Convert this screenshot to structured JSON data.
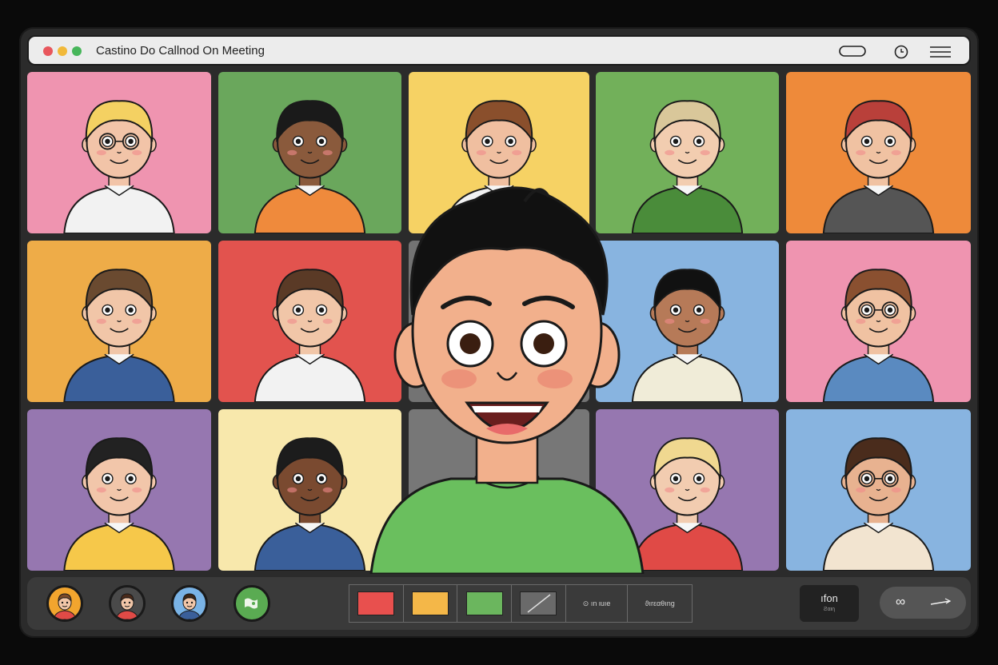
{
  "window": {
    "title": "Castino Do Callnod On Meeting"
  },
  "colors": {
    "dot_red": "#e8565c",
    "dot_yellow": "#f1b93a",
    "dot_green": "#47b65a",
    "background": "#0a0a0a",
    "control_bar": "#3a3a3a"
  },
  "participants": [
    {
      "name": "participant-1",
      "bg": "#ef94b0",
      "skin": "#f2c4a8",
      "hair": "#f4d162",
      "shirt": "#f2f2f2",
      "glasses": true
    },
    {
      "name": "participant-2",
      "bg": "#6aa75c",
      "skin": "#8a5a3c",
      "hair": "#1a1a1a",
      "shirt": "#ef8a3c",
      "glasses": false
    },
    {
      "name": "participant-3",
      "bg": "#f6d264",
      "skin": "#f0bfa0",
      "hair": "#8a4f2c",
      "shirt": "#f2f2f2",
      "glasses": false
    },
    {
      "name": "participant-4",
      "bg": "#72b05a",
      "skin": "#f2cdb0",
      "hair": "#d9c79a",
      "shirt": "#4a8c3a",
      "glasses": false
    },
    {
      "name": "participant-5",
      "bg": "#ee8a3a",
      "skin": "#f0c2a2",
      "hair": "#b9403a",
      "shirt": "#555555",
      "glasses": false
    },
    {
      "name": "participant-6",
      "bg": "#eeac48",
      "skin": "#f1c6a8",
      "hair": "#6a4a30",
      "shirt": "#3a5f9a",
      "glasses": false
    },
    {
      "name": "participant-7",
      "bg": "#e2534e",
      "skin": "#f1c6a8",
      "hair": "#5a3a26",
      "shirt": "#f2f2f2",
      "glasses": false
    },
    {
      "name": "participant-8",
      "bg": "#88b4e0",
      "skin": "#b67a58",
      "hair": "#111111",
      "shirt": "#f0ecd8",
      "glasses": false
    },
    {
      "name": "participant-9",
      "bg": "#ef94b0",
      "skin": "#f0c2a2",
      "hair": "#8a5030",
      "shirt": "#5a8ac0",
      "glasses": true
    },
    {
      "name": "participant-10",
      "bg": "#9677b0",
      "skin": "#f2c6aa",
      "hair": "#222222",
      "shirt": "#f6c84a",
      "glasses": false
    },
    {
      "name": "participant-11",
      "bg": "#f8e8ac",
      "skin": "#7a4a30",
      "hair": "#1c1c1c",
      "shirt": "#3a5f9a",
      "glasses": false
    },
    {
      "name": "participant-12",
      "bg": "#9677b0",
      "skin": "#f2ccb0",
      "hair": "#f0d890",
      "shirt": "#e04a46",
      "glasses": false
    },
    {
      "name": "participant-13",
      "bg": "#88b4e0",
      "skin": "#e8b290",
      "hair": "#4a2c1c",
      "shirt": "#f2e4d0",
      "glasses": true
    }
  ],
  "spotlight": {
    "skin": "#f2b08c",
    "hair": "#111111",
    "shirt": "#6abf5e",
    "behind_tile_colors": [
      "#737373",
      "#777777",
      "#808080"
    ]
  },
  "controls": {
    "avatars": [
      {
        "bg": "#f2a52e",
        "skin": "#f1c6a8",
        "hair": "#7a4a2a",
        "shirt": "#e04a46"
      },
      {
        "bg": "#4a4a4a",
        "skin": "#f1c6a8",
        "hair": "#4a2a1a",
        "shirt": "#e04a46"
      },
      {
        "bg": "#79b3e6",
        "skin": "#f1c6a8",
        "hair": "#3a2618",
        "shirt": "#3a5f9a"
      }
    ],
    "swatches": [
      {
        "color": "#e8504e"
      },
      {
        "color": "#f4b748"
      },
      {
        "color": "#6bb65e"
      }
    ],
    "options": [
      {
        "label": "⊙ ın ιuıe"
      },
      {
        "label": "ϑırεαθıng"
      }
    ],
    "rect_button": {
      "label": "ıfon",
      "sublabel": "Ƨαιιɿ"
    },
    "pill_button": {
      "label": "∞"
    }
  }
}
